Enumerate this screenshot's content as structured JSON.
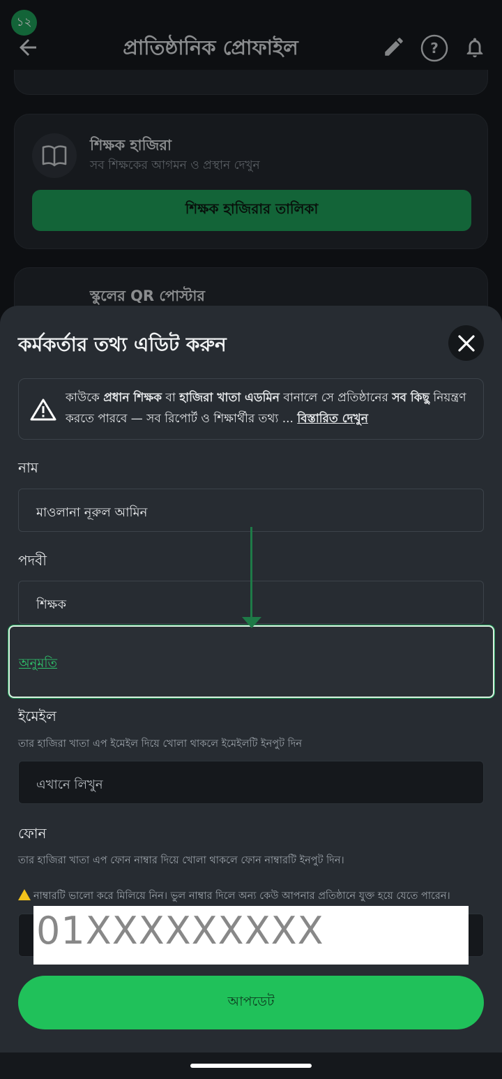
{
  "status": {
    "badge": "১২"
  },
  "header": {
    "title": "প্রাতিষ্ঠানিক প্রোফাইল"
  },
  "background_cards": {
    "attendance": {
      "title": "শিক্ষক হাজিরা",
      "subtitle": "সব শিক্ষকের আগমন ও প্রস্থান দেখুন",
      "button": "শিক্ষক হাজিরার তালিকা"
    },
    "qr": {
      "title": "স্কুলের QR পোস্টার"
    }
  },
  "sheet": {
    "title": "কর্মকর্তার তথ্য এডিট করুন",
    "warning": {
      "p1": "কাউকে ",
      "b1": "প্রধান শিক্ষক",
      "p2": " বা ",
      "b2": "হাজিরা খাতা এডমিন",
      "p3": " বানালে সে প্রতিষ্ঠানের ",
      "b3": "সব কিছু",
      "p4": " নিয়ন্ত্রণ করতে পারবে — সব রিপোর্ট ও শিক্ষার্থীর তথ্য ... ",
      "more": "বিস্তারিত দেখুন"
    },
    "name": {
      "label": "নাম",
      "value": "মাওলানা নূরুল আমিন"
    },
    "designation": {
      "label": "পদবী",
      "value": "শিক্ষক"
    },
    "permission": {
      "link": "অনুমতি"
    },
    "email": {
      "label": "ইমেইল",
      "helper": "তার হাজিরা খাতা এপ ইমেইল দিয়ে খোলা থাকলে ইমেইলটি ইনপুট দিন",
      "placeholder": "এখানে লিখুন"
    },
    "phone": {
      "label": "ফোন",
      "helper": "তার হাজিরা খাতা এপ ফোন নাম্বার দিয়ে খোলা থাকলে ফোন নাম্বারটি ইনপুট দিন।",
      "warning": "নাম্বারটি ভালো করে মিলিয়ে নিন। ভুল নাম্বার দিলে অন্য কেউ আপনার প্রতিষ্ঠানে যুক্ত হয়ে যেতে পারেন।",
      "value": "01XXXXXXXXX"
    },
    "update_button": "আপডেট"
  },
  "colors": {
    "accent": "#20c15a",
    "link": "#2ec26b",
    "warning": "#f2c21b"
  }
}
